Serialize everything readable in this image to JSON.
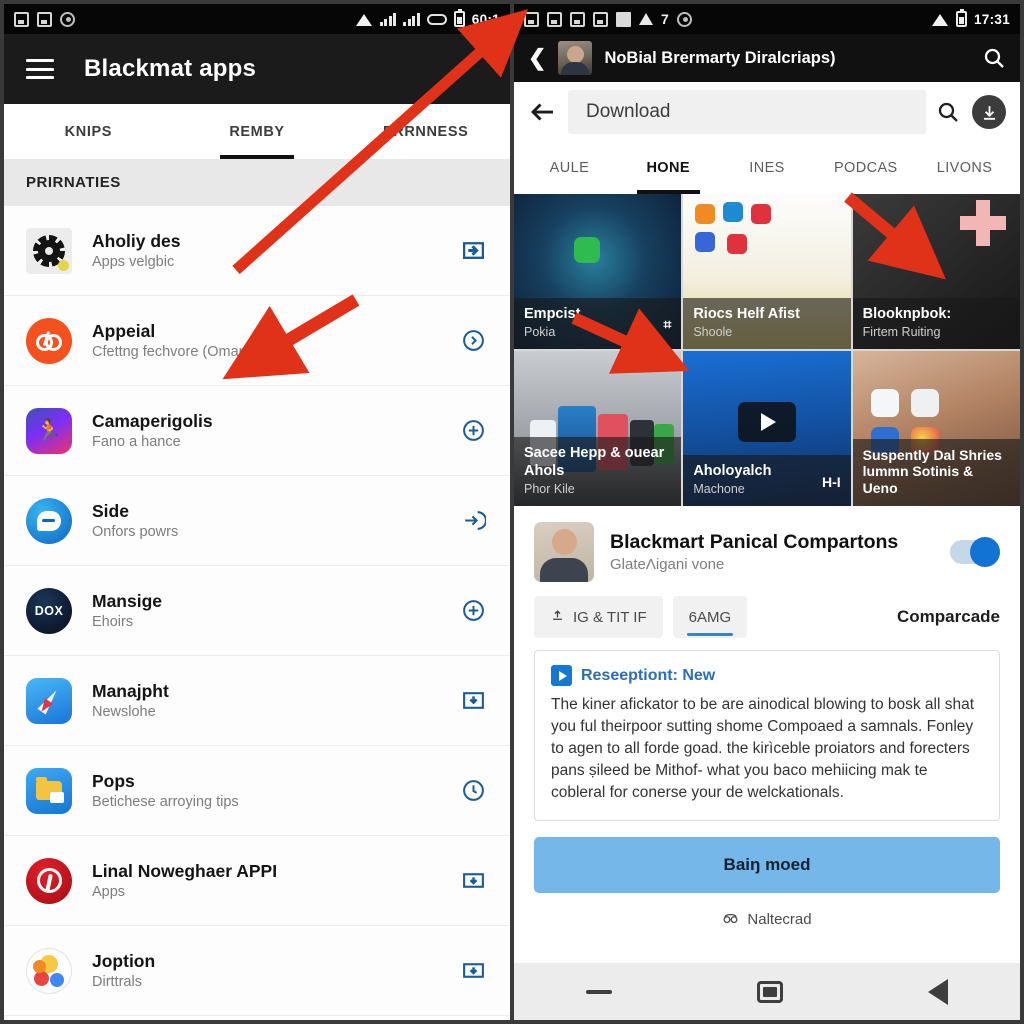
{
  "left_phone": {
    "status_bar": {
      "icons": [
        "screenshot-icon",
        "app-badge-icon",
        "game-icon"
      ],
      "right_icons": [
        "wifi-icon",
        "signal-1-icon",
        "signal-2-icon",
        "usb-icon",
        "battery-icon"
      ],
      "clock": "60:1"
    },
    "appbar": {
      "menu_icon": "hamburger-icon",
      "title": "Blackmat apps"
    },
    "tabs": [
      {
        "label": "KNIPS",
        "active": false
      },
      {
        "label": "REMBY",
        "active": true
      },
      {
        "label": "PRRNNESS",
        "active": false
      }
    ],
    "section_header": "PRIRNATIES",
    "items": [
      {
        "title": "Aholiy des",
        "subtitle": "Apps velgbic",
        "icon": "gear-app-icon",
        "action": "install-icon"
      },
      {
        "title": "Appeial",
        "subtitle": "Cfettng fechvore (Omaners",
        "icon": "orange-music-icon",
        "action": "chevron-right-circle-icon"
      },
      {
        "title": "Camaperigolis",
        "subtitle": "Fano a hance",
        "icon": "runner-app-icon",
        "action": "plus-circle-icon"
      },
      {
        "title": "Side",
        "subtitle": "Onfors powrs",
        "icon": "chat-bubble-icon",
        "action": "login-arrow-icon"
      },
      {
        "title": "Mansige",
        "subtitle": "Ehoirs",
        "icon": "dox-app-icon",
        "action": "plus-circle-icon"
      },
      {
        "title": "Manajpht",
        "subtitle": "Newslohe",
        "icon": "compass-app-icon",
        "action": "download-box-icon"
      },
      {
        "title": "Pops",
        "subtitle": "Betichese arroying tips",
        "icon": "folder-app-icon",
        "action": "clock-circle-icon"
      },
      {
        "title": "Linal Noweghaer APPI",
        "subtitle": "Apps",
        "icon": "red-p-app-icon",
        "action": "download-box-icon"
      },
      {
        "title": "Joption",
        "subtitle": "Dirttrals",
        "icon": "bubbles-app-icon",
        "action": "download-box-icon"
      }
    ]
  },
  "right_phone": {
    "status_bar": {
      "icons": [
        "photo-icon",
        "image-icon",
        "picture-icon",
        "printer-icon",
        "page-icon",
        "triangle-icon",
        "seven-icon",
        "disc-icon"
      ],
      "right_icons": [
        "wifi-icon",
        "battery-icon"
      ],
      "clock": "17:31"
    },
    "dark_bar": {
      "back_icon": "chevron-back-icon",
      "avatar": "user-avatar",
      "title": "NoBial Brermarty Diralcriaps)",
      "search_icon": "search-icon"
    },
    "search_bar": {
      "back_icon": "arrow-back-icon",
      "value": "Download",
      "placeholder": "Download",
      "search_icon": "search-icon",
      "download_icon": "download-circle-icon"
    },
    "top_tabs": [
      {
        "label": "AULE",
        "active": false
      },
      {
        "label": "HONE",
        "active": true
      },
      {
        "label": "INES",
        "active": false
      },
      {
        "label": "PODCAS",
        "active": false
      },
      {
        "label": "LIVONS",
        "active": false
      }
    ],
    "cards": [
      {
        "title": "Empcist",
        "subtitle": "Pokia",
        "badge": "⌗",
        "art": "wave"
      },
      {
        "title": "Riocs Helf Afist",
        "subtitle": "Shoole",
        "badge": "",
        "art": "apps"
      },
      {
        "title": "Blooknpbok:",
        "subtitle": "Firtem Ruiting",
        "badge": "",
        "art": "plus"
      },
      {
        "title": "Sacee Hepp & ouear Ahols",
        "subtitle": "Phor Kile",
        "badge": "",
        "art": "phones"
      },
      {
        "title": "Aholoyalch",
        "subtitle": "Machone",
        "badge": "H-I",
        "art": "video"
      },
      {
        "title": "Suspently Dal Shries lummn Sotinis & Ueno",
        "subtitle": "",
        "badge": "",
        "art": "hand"
      }
    ],
    "profile": {
      "title": "Blackmart Panical Compartons",
      "subtitle": "GlateΛigani vone",
      "toggle_on": true
    },
    "chips": [
      {
        "label": "IG & TIT IF",
        "icon": "upload-icon",
        "selected": false
      },
      {
        "label": "6AMG",
        "icon": "",
        "selected": true
      }
    ],
    "chips_right_label": "Comparcade",
    "note": {
      "icon": "play-badge-icon",
      "title": "Reseeptiont: New",
      "body": "The kiner afickator to be are ainodical blowing to bosk all shat you ful theirpoor sutting shome Compoaed a samnals. Fonley to agen to all forde goad. the kirìceble proiators and forecters pans ṣileed be Mithof- what you baco mehiicing mak te cobleral for conerse your de welckationals."
    },
    "cta_label": "Baiŋ moed",
    "footnote": {
      "icon": "glasses-icon",
      "label": "Naltecrad"
    },
    "nav_bar": [
      "minimize-nav-button",
      "recents-nav-button",
      "back-nav-button"
    ]
  },
  "colors": {
    "appbar": "#1b1b1b",
    "accent_blue": "#1273d4",
    "cta": "#74b7e8",
    "note_title": "#2a6ebb",
    "arrow": "#e03119"
  }
}
